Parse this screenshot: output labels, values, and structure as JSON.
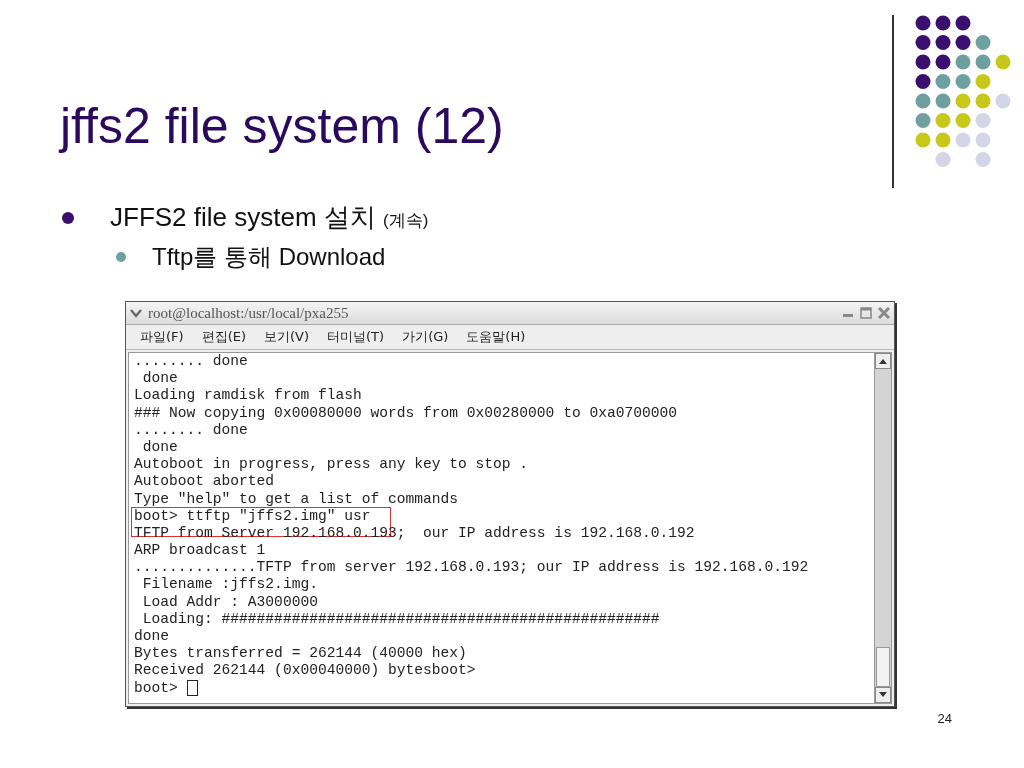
{
  "slide": {
    "title": "jffs2 file system (12)",
    "bullets": [
      {
        "text": "JFFS2 file system 설치",
        "note": "(계속)",
        "children": [
          {
            "text": "Tftp를 통해 Download"
          }
        ]
      }
    ],
    "page_number": "24"
  },
  "terminal": {
    "title": "root@localhost:/usr/local/pxa255",
    "menu": [
      "파일(F)",
      "편집(E)",
      "보기(V)",
      "터미널(T)",
      "가기(G)",
      "도움말(H)"
    ],
    "lines": [
      {
        "text": "........ done",
        "highlighted": false,
        "cursor": false
      },
      {
        "text": " done",
        "highlighted": false,
        "cursor": false
      },
      {
        "text": "Loading ramdisk from flash",
        "highlighted": false,
        "cursor": false
      },
      {
        "text": "### Now copying 0x00080000 words from 0x00280000 to 0xa0700000",
        "highlighted": false,
        "cursor": false
      },
      {
        "text": "........ done",
        "highlighted": false,
        "cursor": false
      },
      {
        "text": " done",
        "highlighted": false,
        "cursor": false
      },
      {
        "text": "Autoboot in progress, press any key to stop .",
        "highlighted": false,
        "cursor": false
      },
      {
        "text": "Autoboot aborted",
        "highlighted": false,
        "cursor": false
      },
      {
        "text": "Type \"help\" to get a list of commands",
        "highlighted": false,
        "cursor": false
      },
      {
        "text": "boot> ttftp \"jffs2.img\" usr",
        "highlighted": true,
        "cursor": false
      },
      {
        "text": "TFTP from Server 192.168.0.193;  our IP address is 192.168.0.192",
        "highlighted": false,
        "cursor": false
      },
      {
        "text": "ARP broadcast 1",
        "highlighted": false,
        "cursor": false
      },
      {
        "text": "..............TFTP from server 192.168.0.193; our IP address is 192.168.0.192",
        "highlighted": false,
        "cursor": false
      },
      {
        "text": " Filename :jffs2.img.",
        "highlighted": false,
        "cursor": false
      },
      {
        "text": " Load Addr : A3000000",
        "highlighted": false,
        "cursor": false
      },
      {
        "text": " Loading: ##################################################",
        "highlighted": false,
        "cursor": false
      },
      {
        "text": "done",
        "highlighted": false,
        "cursor": false
      },
      {
        "text": "Bytes transferred = 262144 (40000 hex)",
        "highlighted": false,
        "cursor": false
      },
      {
        "text": "Received 262144 (0x00040000) bytesboot>",
        "highlighted": false,
        "cursor": false
      },
      {
        "text": "boot>",
        "highlighted": false,
        "cursor": true
      }
    ]
  }
}
